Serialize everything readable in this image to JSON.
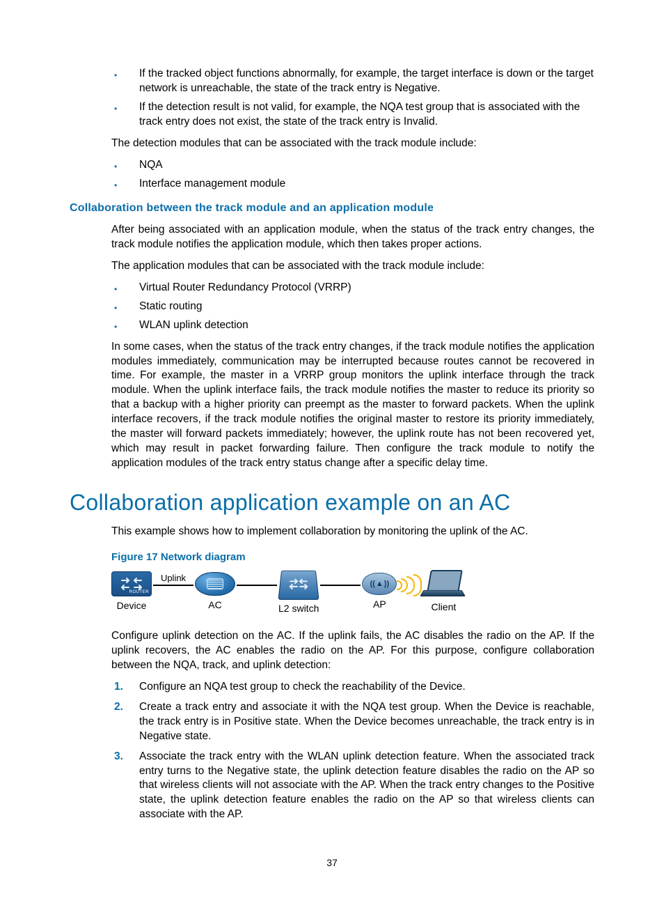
{
  "top_bullets": [
    "If the tracked object functions abnormally, for example, the target interface is down or the target network is unreachable, the state of the track entry is Negative.",
    "If the detection result is not valid, for example, the NQA test group that is associated with the track entry does not exist, the state of the track entry is Invalid."
  ],
  "para_detect": "The detection modules that can be associated with the track module include:",
  "detect_bullets": [
    "NQA",
    "Interface management module"
  ],
  "sub_heading": "Collaboration between the track module and an application module",
  "para_app1": "After being associated with an application module, when the status of the track entry changes, the track module notifies the application module, which then takes proper actions.",
  "para_app2": "The application modules that can be associated with the track module include:",
  "app_bullets": [
    "Virtual Router Redundancy Protocol (VRRP)",
    "Static routing",
    "WLAN uplink detection"
  ],
  "para_long": "In some cases, when the status of the track entry changes, if the track module notifies the application modules immediately, communication may be interrupted because routes cannot be recovered in time. For example, the master in a VRRP group monitors the uplink interface through the track module. When the uplink interface fails, the track module notifies the master to reduce its priority so that a backup with a higher priority can preempt as the master to forward packets. When the uplink interface recovers, if the track module notifies the original master to restore its priority immediately, the master will forward packets immediately; however, the uplink route has not been recovered yet, which may result in packet forwarding failure. Then configure the track module to notify the application modules of the track entry status change after a specific delay time.",
  "section_heading": "Collaboration application example on an AC",
  "para_example": "This example shows how to implement collaboration by monitoring the uplink of the AC.",
  "figure_caption": "Figure 17 Network diagram",
  "diagram": {
    "device": "Device",
    "uplink": "Uplink",
    "ac": "AC",
    "l2": "L2 switch",
    "ap": "AP",
    "client": "Client",
    "router_tag": "ROUTER"
  },
  "para_config": "Configure uplink detection on the AC. If the uplink fails, the AC disables the radio on the AP. If the uplink recovers, the AC enables the radio on the AP. For this purpose, configure collaboration between the NQA, track, and uplink detection:",
  "steps": [
    "Configure an NQA test group to check the reachability of the Device.",
    "Create a track entry and associate it with the NQA test group. When the Device is reachable, the track entry is in Positive state. When the Device becomes unreachable, the track entry is in Negative state.",
    "Associate the track entry with the WLAN uplink detection feature. When the associated track entry turns to the Negative state, the uplink detection feature disables the radio on the AP so that wireless clients will not associate with the AP. When the track entry changes to the Positive state, the uplink detection feature enables the radio on the AP so that wireless clients can associate with the AP."
  ],
  "page_number": "37"
}
